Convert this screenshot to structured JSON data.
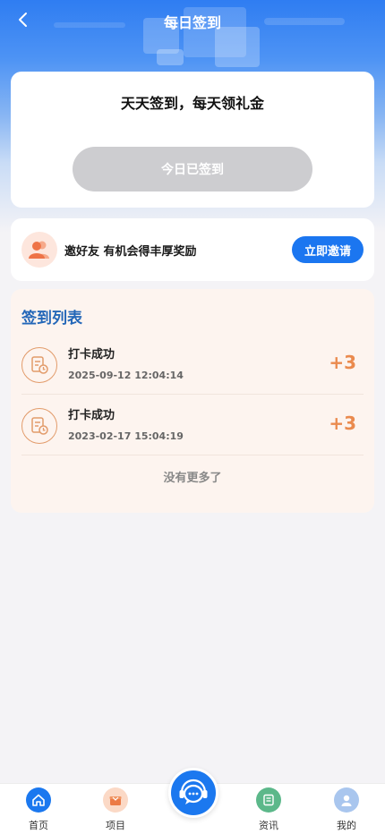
{
  "nav": {
    "title": "每日签到",
    "back_icon": "chevron-left-icon"
  },
  "sign": {
    "slogan": "天天签到，每天领礼金",
    "button_label": "今日已签到"
  },
  "invite": {
    "text": "邀好友 有机会得丰厚奖励",
    "button_label": "立即邀请",
    "icon": "users-icon"
  },
  "list": {
    "title": "签到列表",
    "records": [
      {
        "title": "打卡成功",
        "time": "2025-09-12 12:04:14",
        "points": "+3"
      },
      {
        "title": "打卡成功",
        "time": "2023-02-17 15:04:19",
        "points": "+3"
      }
    ],
    "footer": "没有更多了"
  },
  "tabbar": {
    "items": [
      {
        "label": "首页",
        "icon": "home-icon"
      },
      {
        "label": "项目",
        "icon": "gift-icon"
      },
      {
        "label": "资讯",
        "icon": "news-icon"
      },
      {
        "label": "我的",
        "icon": "user-icon"
      }
    ],
    "center_icon": "customer-service-icon"
  },
  "colors": {
    "primary": "#1b76f0",
    "accent": "#ea8a4e",
    "list_title": "#2467b8"
  }
}
